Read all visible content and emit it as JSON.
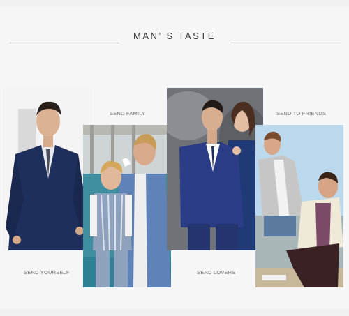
{
  "header": {
    "title": "MAN’ S TASTE"
  },
  "sections": [
    {
      "id": "yourself",
      "caption": "SEND YOURSELF"
    },
    {
      "id": "family",
      "caption": "SEND FAMILY"
    },
    {
      "id": "lovers",
      "caption": "SEND LOVERS"
    },
    {
      "id": "friends",
      "caption": "SEND TO FRIENDS"
    }
  ],
  "colors": {
    "background": "#f6f6f6",
    "navy_suit": "#1f2f5c",
    "text": "#3a3a3a"
  }
}
